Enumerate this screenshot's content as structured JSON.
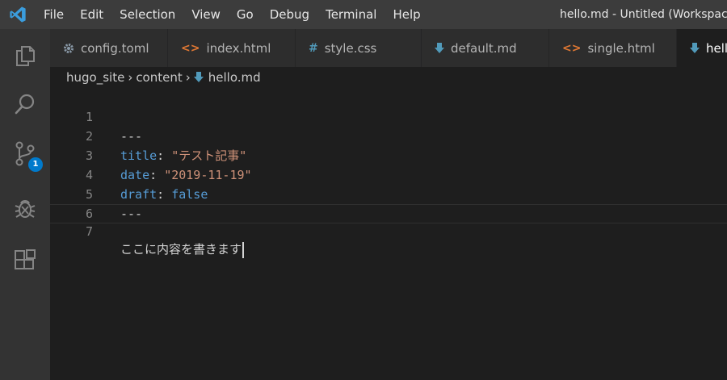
{
  "menu": [
    "File",
    "Edit",
    "Selection",
    "View",
    "Go",
    "Debug",
    "Terminal",
    "Help"
  ],
  "window_title": "hello.md - Untitled (Workspace)",
  "activity": {
    "explorer_icon": "files-icon",
    "search_icon": "search-icon",
    "scm_icon": "source-control-icon",
    "scm_badge": "1",
    "debug_icon": "debug-icon",
    "extensions_icon": "extensions-icon"
  },
  "tabs": [
    {
      "label": "config.toml",
      "icon": "gear-icon",
      "active": false
    },
    {
      "label": "index.html",
      "icon": "html-icon",
      "active": false
    },
    {
      "label": "style.css",
      "icon": "css-icon",
      "active": false
    },
    {
      "label": "default.md",
      "icon": "markdown-icon",
      "active": false
    },
    {
      "label": "single.html",
      "icon": "html-icon",
      "active": false
    },
    {
      "label": "hello.md",
      "icon": "markdown-icon",
      "active": true
    }
  ],
  "breadcrumb": [
    "hugo_site",
    "content",
    "hello.md"
  ],
  "editor": {
    "lines": [
      {
        "num": "1",
        "text": "---"
      },
      {
        "num": "2",
        "key": "title",
        "sep": ": ",
        "value": "\"テスト記事\""
      },
      {
        "num": "3",
        "key": "date",
        "sep": ": ",
        "value": "\"2019-11-19\""
      },
      {
        "num": "4",
        "key": "draft",
        "sep": ": ",
        "value": "false"
      },
      {
        "num": "5",
        "text": "---"
      },
      {
        "num": "6",
        "text": ""
      },
      {
        "num": "7",
        "text": "ここに内容を書きます"
      }
    ],
    "current_line": "7"
  },
  "colors": {
    "accent": "#007acc",
    "key": "#569cd6",
    "string": "#ce9178",
    "background": "#1e1e1e"
  }
}
